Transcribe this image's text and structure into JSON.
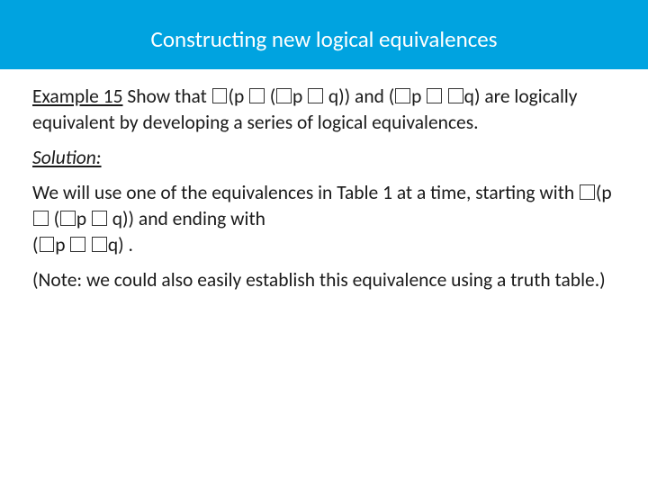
{
  "title": "Constructing new logical equivalences",
  "example_label": "Example 15",
  "example_text_1": " Show that ",
  "expr_a_1": "(p ",
  "expr_a_2": " (",
  "expr_a_3": "p ",
  "expr_a_4": " q)) and  (",
  "expr_a_5": "p ",
  "expr_a_6": " ",
  "expr_a_7": "q) are logically equivalent by developing a series of logical equivalences.",
  "solution_label": "Solution:",
  "solution_p1_a": "We will use one of the equivalences in Table 1 at a time, starting with ",
  "solution_p1_b": "(p ",
  "solution_p1_c": " (",
  "solution_p1_d": "p ",
  "solution_p1_e": " q))  and ending with",
  "solution_p2_a": "(",
  "solution_p2_b": "p ",
  "solution_p2_c": " ",
  "solution_p2_d": "q) .",
  "note": "(Note: we could also easily establish this equivalence using a truth table.)"
}
